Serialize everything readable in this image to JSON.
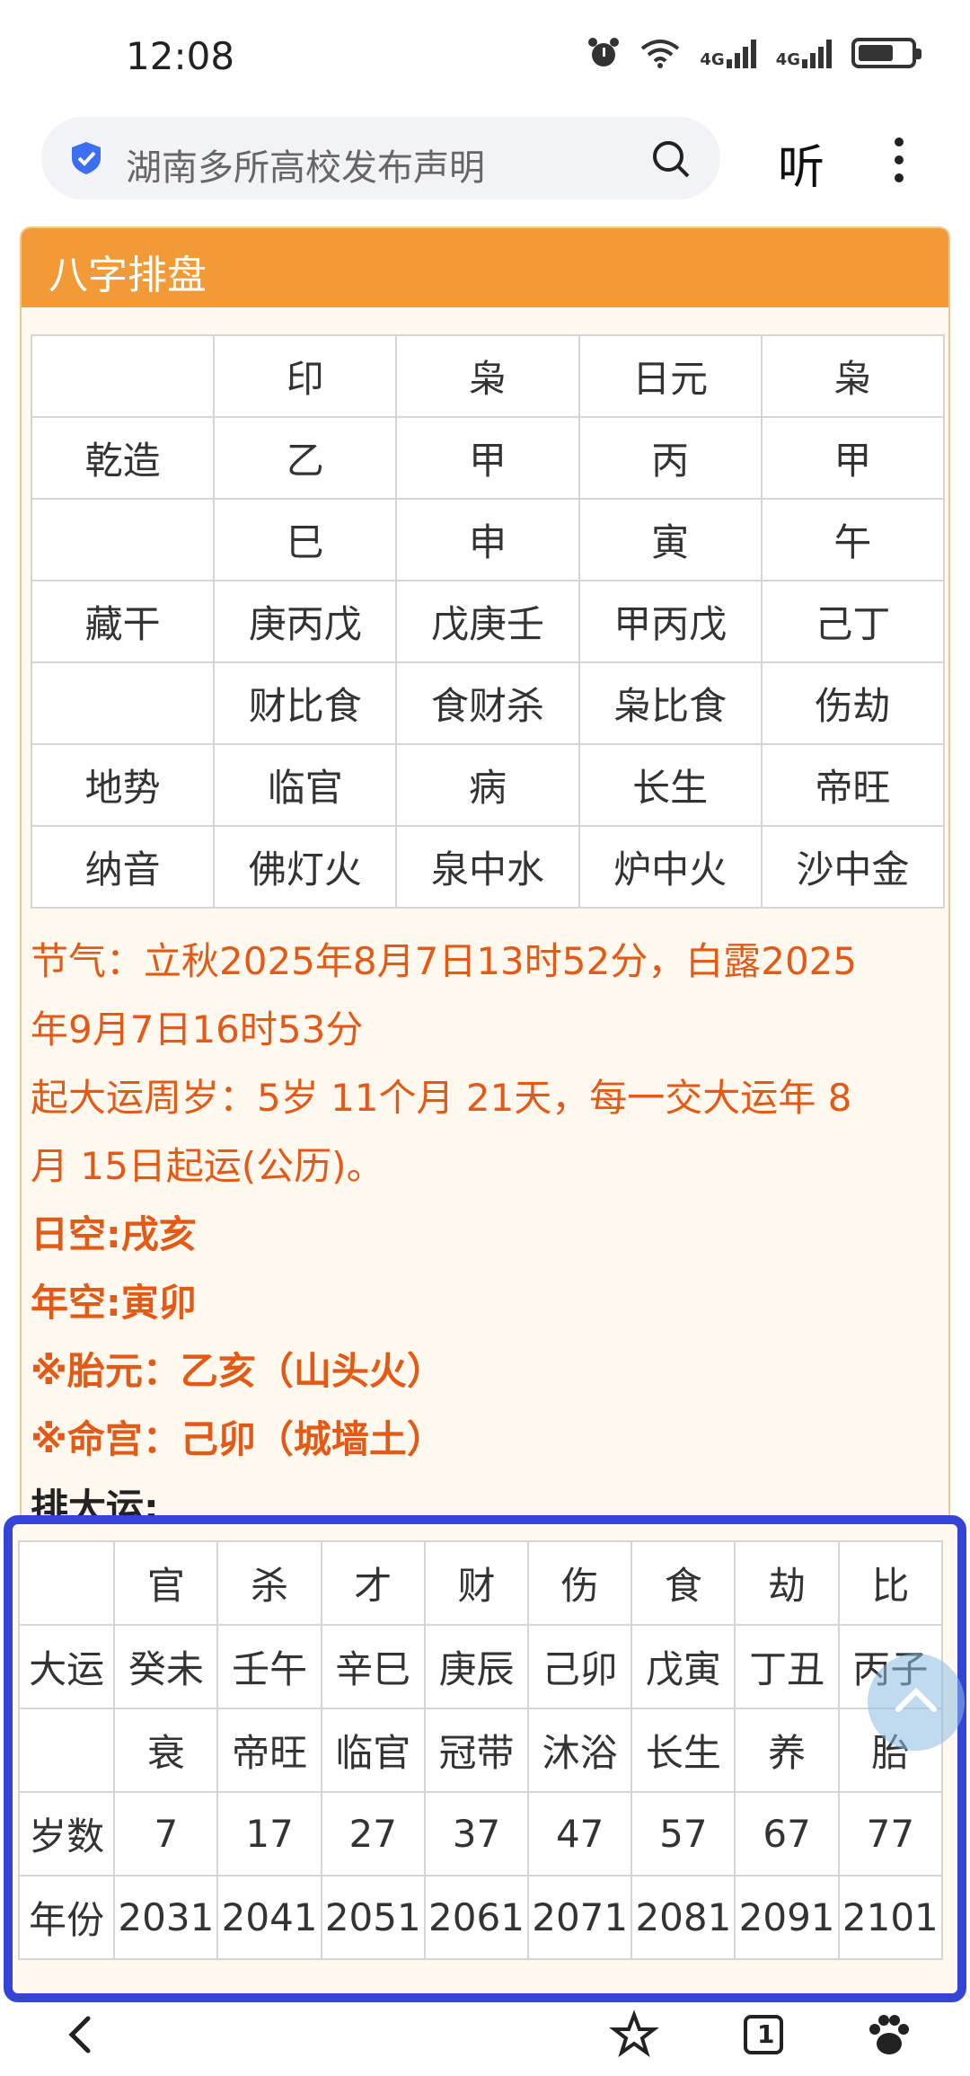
{
  "status_bar": {
    "time": "12:08",
    "network1": "4G",
    "network2": "4G"
  },
  "search": {
    "placeholder": "湖南多所高校发布声明",
    "listen_label": "听"
  },
  "card": {
    "title": "八字排盘"
  },
  "bazi_table": {
    "rows": [
      [
        "",
        "印",
        "枭",
        "日元",
        "枭"
      ],
      [
        "乾造",
        "乙",
        "甲",
        "丙",
        "甲"
      ],
      [
        "",
        "巳",
        "申",
        "寅",
        "午"
      ],
      [
        "藏干",
        "庚丙戊",
        "戊庚壬",
        "甲丙戊",
        "己丁"
      ],
      [
        "",
        "财比食",
        "食财杀",
        "枭比食",
        "伤劫"
      ],
      [
        "地势",
        "临官",
        "病",
        "长生",
        "帝旺"
      ],
      [
        "纳音",
        "佛灯火",
        "泉中水",
        "炉中火",
        "沙中金"
      ]
    ]
  },
  "info": {
    "jieqi_1": "节气：立秋2025年8月7日13时52分，白露2025",
    "jieqi_2": "年9月7日16时53分",
    "qiyun_1": "起大运周岁：5岁 11个月 21天，每一交大运年 8",
    "qiyun_2": "月 15日起运(公历)。",
    "rikong": "日空:戌亥",
    "niankong": "年空:寅卯",
    "taiyuan": "※胎元：乙亥（山头火）",
    "minggong": "※命宫：己卯（城墙土）",
    "pai_dayun": "排大运:"
  },
  "dayun_table": {
    "rows": [
      [
        "",
        "官",
        "杀",
        "才",
        "财",
        "伤",
        "食",
        "劫",
        "比"
      ],
      [
        "大运",
        "癸未",
        "壬午",
        "辛巳",
        "庚辰",
        "己卯",
        "戊寅",
        "丁丑",
        "丙子"
      ],
      [
        "",
        "衰",
        "帝旺",
        "临官",
        "冠带",
        "沐浴",
        "长生",
        "养",
        "胎"
      ],
      [
        "岁数",
        "7",
        "17",
        "27",
        "37",
        "47",
        "57",
        "67",
        "77"
      ],
      [
        "年份",
        "2031",
        "2041",
        "2051",
        "2061",
        "2071",
        "2081",
        "2091",
        "2101"
      ]
    ]
  },
  "bottom_nav": {
    "tab_count": "1"
  },
  "colors": {
    "header_orange": "#f29a35",
    "text_orange": "#e35a16",
    "highlight_blue": "#3344d6"
  }
}
